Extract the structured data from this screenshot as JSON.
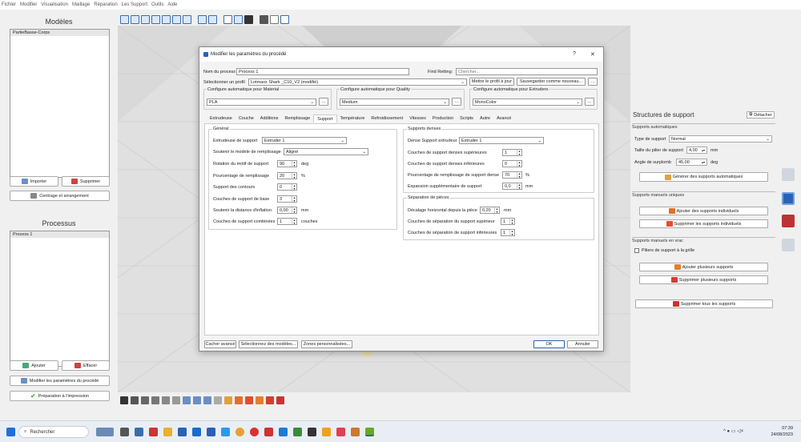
{
  "menu": [
    "Fichier",
    "Modifier",
    "Visualisation",
    "Maillage",
    "Réparation",
    "Les Support",
    "Outils",
    "Aide"
  ],
  "models_panel": {
    "title": "Modèles",
    "items": [
      "PartieBasse-Corps"
    ],
    "import_label": "Importer",
    "delete_label": "Supprimer",
    "center_label": "Centrage et arrangement"
  },
  "process_panel": {
    "title": "Processus",
    "items": [
      "Process 1"
    ],
    "add_label": "Ajouter",
    "erase_label": "Effacer",
    "modify_label": "Modifier les paramètres du procédé",
    "prepare_label": "Préparation à l'impression"
  },
  "dialog": {
    "title": "Modifier les paramètres du procédé",
    "help": "?",
    "close": "✕",
    "process_name_label": "Nom du process",
    "process_name_value": "Process 1",
    "find_label": "Find Retting:",
    "find_placeholder": "Chercher...",
    "profile_label": "Sélectionner un profil",
    "profile_value": "Lotmaxx Shark _C10_V2 (modifié)",
    "update_profile_label": "Mettre le profil à jour",
    "save_as_label": "Sauvegarder comme nouveau...",
    "ellipsis": "...",
    "material_title": "Configure automatique pour Material",
    "material_value": "PLA",
    "quality_title": "Configure automatique pour Quality",
    "quality_value": "Medium",
    "extruders_title": "Configure automatique pour Extruders",
    "extruders_value": "MonoColor",
    "tabs": [
      "Extrudeuse",
      "Couche",
      "Additions",
      "Remplissage",
      "Support",
      "Température",
      "Refroidissement",
      "Vitesses",
      "Production",
      "Scripts",
      "Autre",
      "Avancé"
    ],
    "general": {
      "title": "Général",
      "extruder_label": "Extrudeuse de support",
      "extruder_value": "Extruder 1",
      "pattern_label": "Soutenir le modèle de remplissage",
      "pattern_value": "Aligné",
      "rotation_label": "Rotation du motif de support",
      "rotation_value": "90",
      "rotation_unit": "deg",
      "infill_label": "Pourcentage de remplissage",
      "infill_value": "20",
      "infill_unit": "%",
      "contours_label": "Support des contours",
      "contours_value": "0",
      "base_label": "Couches de support de base",
      "base_value": "3",
      "inflate_label": "Soutenir la distance d'inflation",
      "inflate_value": "0,00",
      "inflate_unit": "mm",
      "combined_label": "Couches de support combinées",
      "combined_value": "1",
      "combined_unit": "couches"
    },
    "dense": {
      "title": "Supports denses",
      "extruder_label": "Dense Support extrudeur",
      "extruder_value": "Extruder 1",
      "top_label": "Couches de support denses supérieures",
      "top_value": "1",
      "bottom_label": "Couches de support denses inférieures",
      "bottom_value": "0",
      "pct_label": "Pourcentage de remplissage de support dense",
      "pct_value": "70",
      "pct_unit": "%",
      "expansion_label": "Expansion supplémentaire de support",
      "expansion_value": "0,0",
      "expansion_unit": "mm"
    },
    "separation": {
      "title": "Séparation de pièces",
      "offset_label": "Décalage horizontal depuis la pièce",
      "offset_value": "0,20",
      "offset_unit": "mm",
      "upper_label": "Couches de séparation du support supérieur",
      "upper_value": "1",
      "lower_label": "Couches de séparation de support inférieures",
      "lower_value": "1"
    },
    "hide_advanced": "Cacher avancé",
    "select_models": "Sélectionnez des modèles...",
    "custom_zones": "Zones personnalisées...",
    "ok": "OK",
    "cancel": "Annuler"
  },
  "support_panel": {
    "title": "Structures de support",
    "detach": "Détacher",
    "auto_section": "Supports automatiques",
    "type_label": "Type de support",
    "type_value": "Normal",
    "pillar_label": "Taille du pilier de support",
    "pillar_value": "4,00",
    "pillar_unit": "mm",
    "overhang_label": "Angle de surplomb",
    "overhang_value": "45,00",
    "overhang_unit": "deg",
    "generate_label": "Générer des supports automatiques",
    "manual_unique_section": "Supports manuels uniques",
    "add_individual": "Ajouter des supports individuels",
    "remove_individual": "Supprimer les supports individuels",
    "manual_bulk_section": "Supports manuels en vrac",
    "grid_pillars": "Piliers de support à la grille",
    "add_multiple": "Ajouter plusieurs supports",
    "remove_multiple": "Supprimer plusieurs supports",
    "remove_all": "Supprimer tous les supports"
  },
  "taskbar": {
    "search": "Rechercher",
    "time": "07:39",
    "date": "24/08/2023"
  },
  "colors": {
    "accent": "#2a62b5",
    "viewport_bg": "#d9d9d9",
    "taskbar_bg": "#e9eef5"
  }
}
